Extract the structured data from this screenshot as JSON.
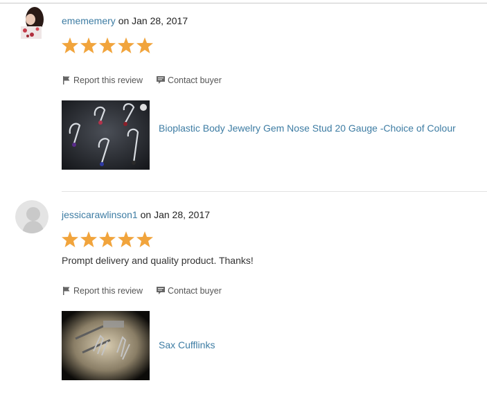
{
  "reviews": [
    {
      "username": "emememery",
      "date_text": "on Jan 28, 2017",
      "rating": 5,
      "text": "",
      "report_label": "Report this review",
      "contact_label": "Contact buyer",
      "product_title": "Bioplastic Body Jewelry Gem Nose Stud 20 Gauge -Choice of Colour"
    },
    {
      "username": "jessicarawlinson1",
      "date_text": "on Jan 28, 2017",
      "rating": 5,
      "text": "Prompt delivery and quality product. Thanks!",
      "report_label": "Report this review",
      "contact_label": "Contact buyer",
      "product_title": "Sax Cufflinks"
    }
  ],
  "colors": {
    "link": "#3d7ca3",
    "star": "#f1a43c"
  },
  "icons": {
    "report": "flag-icon",
    "contact": "chat-bubble-icon",
    "star": "star-icon"
  }
}
